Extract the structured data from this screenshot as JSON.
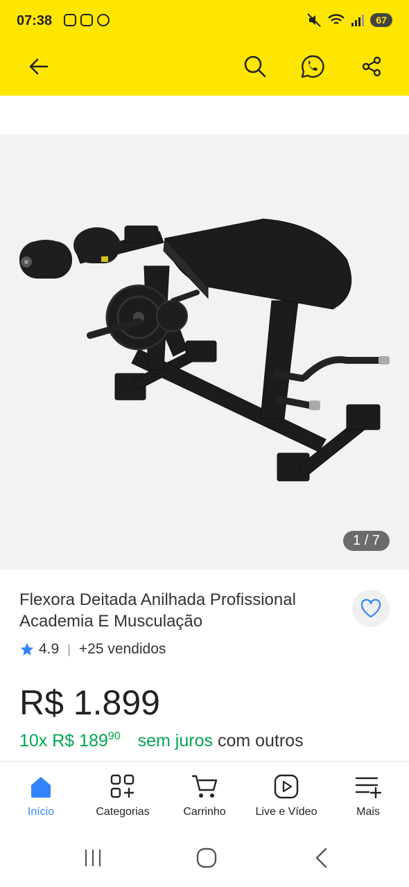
{
  "status_bar": {
    "time": "07:38",
    "battery": "67"
  },
  "header": {
    "back_icon": "arrow-left-icon",
    "search_icon": "search-icon",
    "whatsapp_icon": "whatsapp-icon",
    "share_icon": "share-icon",
    "background_color": "#FFE600"
  },
  "product": {
    "image_counter": "1 / 7",
    "title": "Flexora Deitada Anilhada Profissional Academia E Musculação",
    "rating": "4.9",
    "sold": "+25 vendidos",
    "price": "R$ 1.899",
    "installments_prefix": "10x R$ 189",
    "installments_cents": "90",
    "installments_no_interest": "sem juros",
    "installments_suffix": "com outros"
  },
  "tabbar": {
    "items": [
      {
        "label": "Início",
        "icon": "home-icon",
        "active": true
      },
      {
        "label": "Categorias",
        "icon": "categories-icon",
        "active": false
      },
      {
        "label": "Carrinho",
        "icon": "cart-icon",
        "active": false
      },
      {
        "label": "Live e Vídeo",
        "icon": "play-icon",
        "active": false
      },
      {
        "label": "Mais",
        "icon": "menu-plus-icon",
        "active": false
      }
    ],
    "active_color": "#3483fa"
  },
  "colors": {
    "accent_green": "#00a650",
    "brand_blue": "#3483fa"
  }
}
